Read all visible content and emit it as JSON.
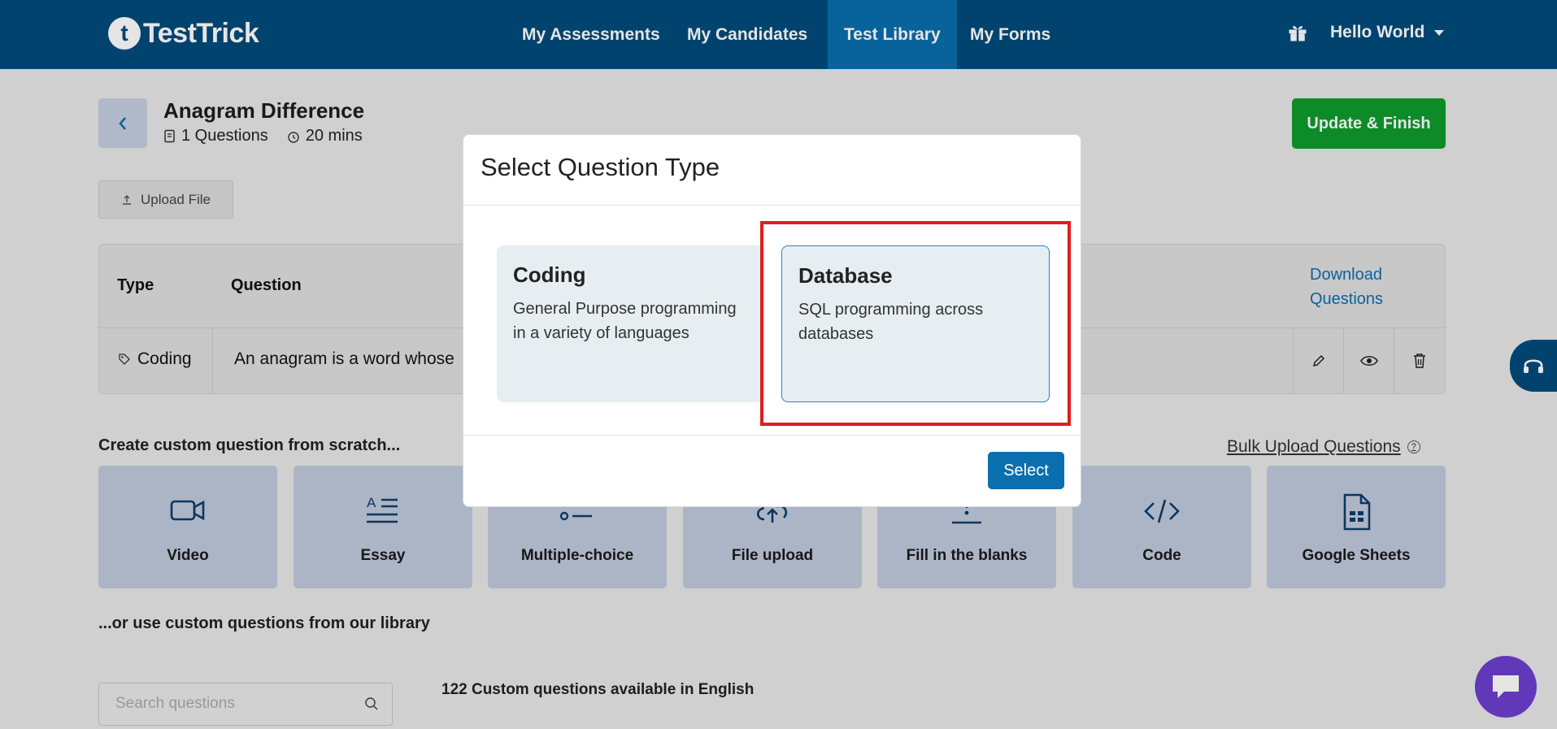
{
  "nav": {
    "logo_mark": "t",
    "logo_text": "TestTrick",
    "items": [
      "My Assessments",
      "My Candidates",
      "Test Library",
      "My Forms"
    ],
    "active_item": "Test Library",
    "user_name": "Hello World",
    "gift_icon": "gift-icon"
  },
  "header": {
    "title": "Anagram Difference",
    "questions_count": "1 Questions",
    "duration": "20 mins",
    "update_button": "Update & Finish",
    "upload_button": "Upload File"
  },
  "table": {
    "columns": [
      "Type",
      "Question"
    ],
    "download_link_line1": "Download",
    "download_link_line2": "Questions",
    "rows": [
      {
        "type": "Coding",
        "question": "An anagram is a word whose"
      }
    ]
  },
  "create_section": {
    "heading": "Create custom question from scratch...",
    "bulk_upload": "Bulk Upload Questions",
    "help_glyph": "?",
    "cards": [
      {
        "label": "Video",
        "icon": "video-camera-icon"
      },
      {
        "label": "Essay",
        "icon": "essay-icon"
      },
      {
        "label": "Multiple-choice",
        "icon": "list-icon"
      },
      {
        "label": "File upload",
        "icon": "cloud-upload-icon"
      },
      {
        "label": "Fill in the blanks",
        "icon": "fill-blank-icon"
      },
      {
        "label": "Code",
        "icon": "code-icon"
      },
      {
        "label": "Google Sheets",
        "icon": "sheets-icon"
      }
    ]
  },
  "library_section": {
    "heading": "...or use custom questions from our library",
    "search_placeholder": "Search questions",
    "available_text": "122 Custom questions available in English"
  },
  "modal": {
    "title": "Select Question Type",
    "options": [
      {
        "title": "Coding",
        "description": "General Purpose programming in a variety of languages",
        "selected": false
      },
      {
        "title": "Database",
        "description": "SQL programming across databases",
        "selected": true
      }
    ],
    "select_button": "Select"
  },
  "colors": {
    "nav_bg": "#004b7c",
    "nav_active": "#0a6fae",
    "update_button": "#0f9b2e",
    "highlight": "#e01e1e",
    "chat_bubble": "#6c3fcf"
  }
}
